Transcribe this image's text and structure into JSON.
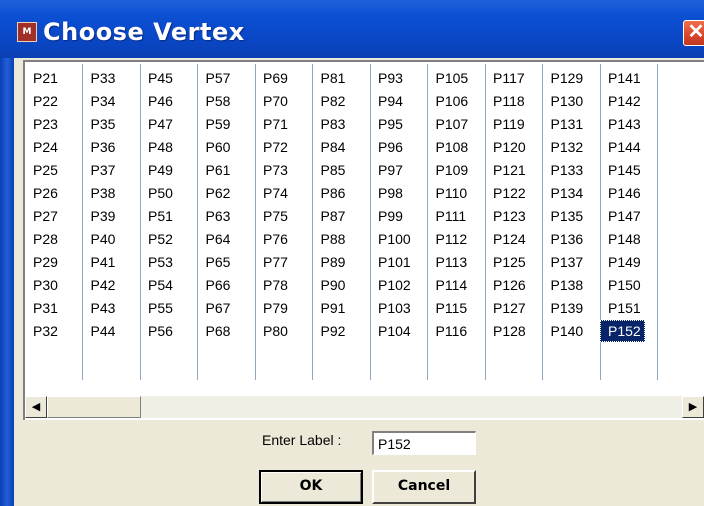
{
  "window": {
    "title": "Choose Vertex",
    "app_icon_label": "M",
    "close_glyph": "✕"
  },
  "vertex_list": {
    "columns": [
      [
        "P21",
        "P22",
        "P23",
        "P24",
        "P25",
        "P26",
        "P27",
        "P28",
        "P29",
        "P30",
        "P31",
        "P32"
      ],
      [
        "P33",
        "P34",
        "P35",
        "P36",
        "P37",
        "P38",
        "P39",
        "P40",
        "P41",
        "P42",
        "P43",
        "P44"
      ],
      [
        "P45",
        "P46",
        "P47",
        "P48",
        "P49",
        "P50",
        "P51",
        "P52",
        "P53",
        "P54",
        "P55",
        "P56"
      ],
      [
        "P57",
        "P58",
        "P59",
        "P60",
        "P61",
        "P62",
        "P63",
        "P64",
        "P65",
        "P66",
        "P67",
        "P68"
      ],
      [
        "P69",
        "P70",
        "P71",
        "P72",
        "P73",
        "P74",
        "P75",
        "P76",
        "P77",
        "P78",
        "P79",
        "P80"
      ],
      [
        "P81",
        "P82",
        "P83",
        "P84",
        "P85",
        "P86",
        "P87",
        "P88",
        "P89",
        "P90",
        "P91",
        "P92"
      ],
      [
        "P93",
        "P94",
        "P95",
        "P96",
        "P97",
        "P98",
        "P99",
        "P100",
        "P101",
        "P102",
        "P103",
        "P104"
      ],
      [
        "P105",
        "P106",
        "P107",
        "P108",
        "P109",
        "P110",
        "P111",
        "P112",
        "P113",
        "P114",
        "P115",
        "P116"
      ],
      [
        "P117",
        "P118",
        "P119",
        "P120",
        "P121",
        "P122",
        "P123",
        "P124",
        "P125",
        "P126",
        "P127",
        "P128"
      ],
      [
        "P129",
        "P130",
        "P131",
        "P132",
        "P133",
        "P134",
        "P135",
        "P136",
        "P137",
        "P138",
        "P139",
        "P140"
      ],
      [
        "P141",
        "P142",
        "P143",
        "P144",
        "P145",
        "P146",
        "P147",
        "P148",
        "P149",
        "P150",
        "P151",
        "P152"
      ]
    ],
    "selected": "P152",
    "scroll_left_glyph": "◀",
    "scroll_right_glyph": "▶"
  },
  "label_field": {
    "label": "Enter Label :",
    "value": "P152"
  },
  "buttons": {
    "ok": "OK",
    "cancel": "Cancel"
  },
  "colors": {
    "titlebar": "#0b4fd2",
    "selection": "#0a246a",
    "dialog_bg": "#ece9d8"
  }
}
